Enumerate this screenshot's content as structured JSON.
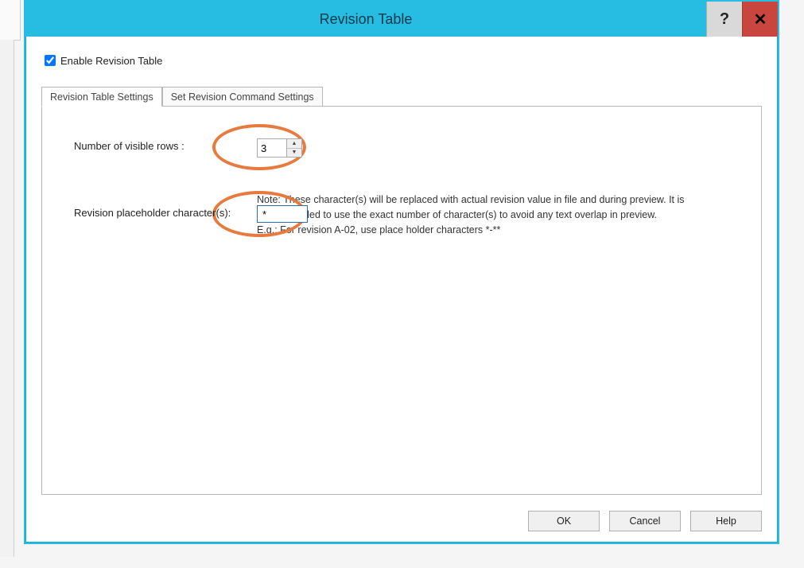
{
  "dialog": {
    "title": "Revision Table"
  },
  "enable": {
    "label": "Enable Revision Table",
    "checked": true
  },
  "tabs": {
    "settings": "Revision Table Settings",
    "command": "Set Revision Command Settings"
  },
  "fields": {
    "rows_label": "Number of visible rows :",
    "rows_value": "3",
    "placeholder_label": "Revision placeholder character(s):",
    "placeholder_value": "*"
  },
  "note": {
    "line1": "Note: These character(s) will be replaced with actual revision value in file and during preview. It is recommended to use the exact number of character(s) to avoid any text overlap in preview.",
    "line2": "E.g.: For revision A-02, use place holder characters *-**"
  },
  "buttons": {
    "ok": "OK",
    "cancel": "Cancel",
    "help": "Help"
  }
}
